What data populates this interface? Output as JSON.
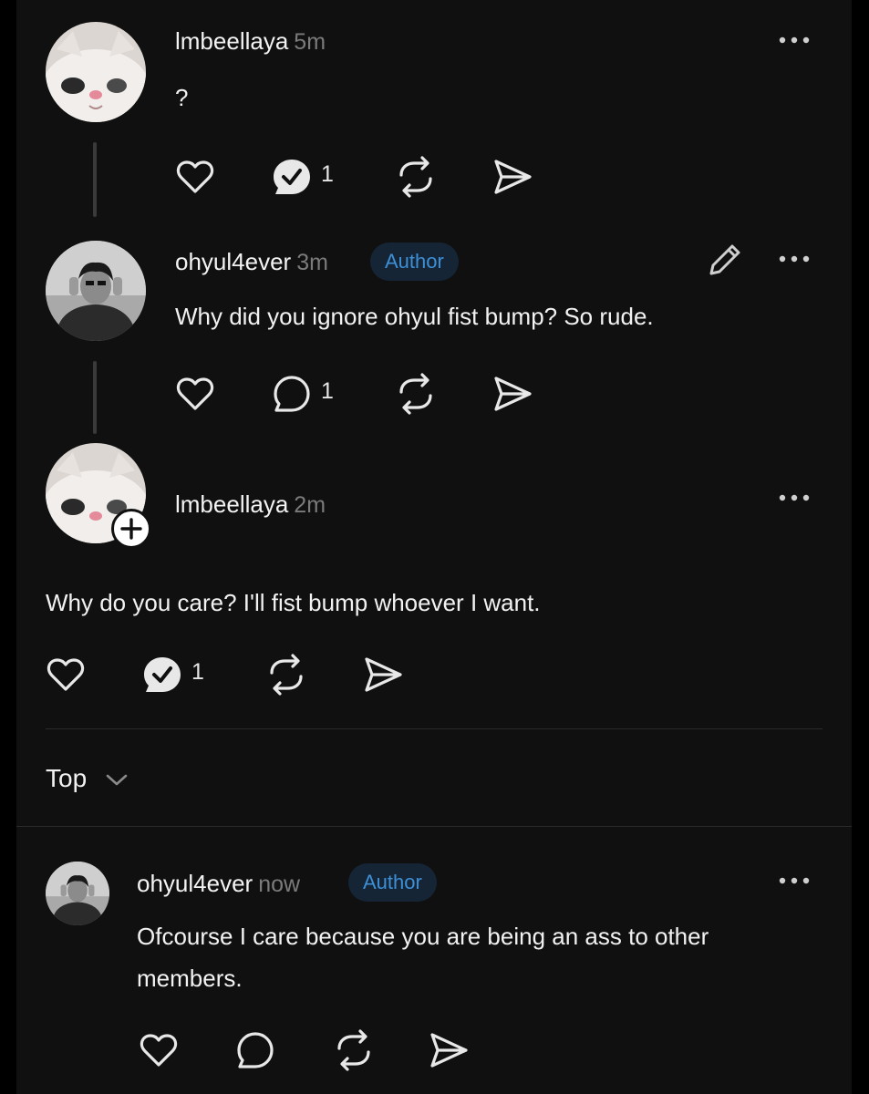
{
  "posts": [
    {
      "username": "lmbeellaya",
      "time": "5m",
      "text": "?",
      "replies": "1"
    },
    {
      "username": "ohyul4ever",
      "time": "3m",
      "badge": "Author",
      "text": "Why did you ignore ohyul fist bump? So rude.",
      "replies": "1"
    },
    {
      "username": "lmbeellaya",
      "time": "2m",
      "text": "Why do you care? I'll fist bump whoever I want.",
      "replies": "1"
    }
  ],
  "sort": {
    "label": "Top"
  },
  "comment": {
    "username": "ohyul4ever",
    "time": "now",
    "badge": "Author",
    "text_line1": "Ofcourse I care because you are being an ass to other",
    "text_line2": "members."
  },
  "icons": {
    "like": "heart-icon",
    "reply": "comment-icon",
    "replied": "comment-check-icon",
    "repost": "repost-icon",
    "share": "send-icon",
    "more": "more-icon",
    "edit": "pencil-icon",
    "follow": "plus-icon",
    "sort": "chevron-down-icon"
  },
  "colors": {
    "background": "#101010",
    "badge_text": "#3d8fd6",
    "badge_bg": "#152536",
    "muted": "#7b7b7b"
  }
}
